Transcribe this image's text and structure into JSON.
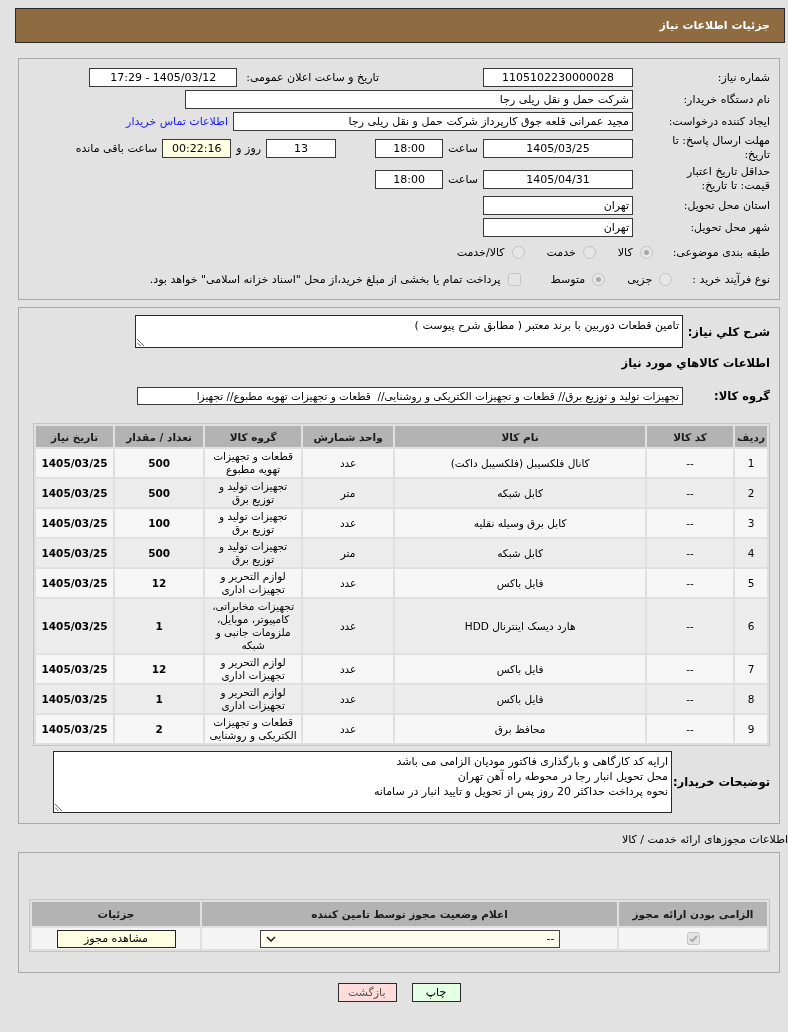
{
  "header": {
    "title": "جزئیات اطلاعات نیاز"
  },
  "need": {
    "need_number": {
      "label": "شماره نیاز:",
      "value": "1105102230000028"
    },
    "announced": {
      "label": "تاریخ و ساعت اعلان عمومی:",
      "value": "1405/03/12 - 17:29"
    },
    "buyer_org": {
      "label": "نام دستگاه خریدار:",
      "value": "شرکت حمل و نقل ریلی رجا"
    },
    "requester": {
      "label": "ایجاد کننده درخواست:",
      "value": "مجید عمرانی قلعه جوق کارپرداز شرکت حمل و نقل ریلی رجا",
      "link": "اطلاعات تماس خریدار"
    },
    "reply_deadline": {
      "label": "مهلت ارسال پاسخ: تا تاریخ:",
      "date": "1405/03/25",
      "time_label": "ساعت",
      "time": "18:00",
      "days": "13",
      "days_label": "روز و",
      "remaining": "00:22:16",
      "remaining_label": "ساعت باقی مانده"
    },
    "price_validity": {
      "label": "حداقل تاریخ اعتبار قیمت: تا تاریخ:",
      "date": "1405/04/31",
      "time_label": "ساعت",
      "time": "18:00"
    },
    "delivery_province": {
      "label": "استان محل تحویل:",
      "value": "تهران"
    },
    "delivery_city": {
      "label": "شهر محل تحویل:",
      "value": "تهران"
    },
    "subject_category": {
      "label": "طبقه بندی موضوعی:",
      "options": [
        {
          "label": "کالا",
          "selected": true,
          "disabled": true
        },
        {
          "label": "خدمت",
          "selected": false,
          "disabled": true
        },
        {
          "label": "کالا/خدمت",
          "selected": false,
          "disabled": true
        }
      ]
    },
    "purchase_process": {
      "label": "نوع فرآیند خرید :",
      "options": [
        {
          "label": "جزیی",
          "selected": false,
          "disabled": true
        },
        {
          "label": "متوسط",
          "selected": true,
          "disabled": true
        }
      ],
      "treasury_option": {
        "label": "پرداخت تمام یا بخشی از مبلغ خرید،از محل \"اسناد خزانه اسلامی\" خواهد بود.",
        "checked": false,
        "disabled": true
      }
    }
  },
  "items": {
    "description_label": "شرح کلي نياز:",
    "description": "تامین قطعات دوربین با برند معتبر ( مطابق شرح پیوست )",
    "heading": "اطلاعات کالاهاي مورد نياز",
    "group_label": "گروه کالا:",
    "group_value": "تجهیزات تولید و توزیع برق// قطعات و تجهیزات الکتریکی و روشنایی//  قطعات و تجهیزات تهویه مطبوع// تجهیزا",
    "table": {
      "columns": [
        "ردیف",
        "کد کالا",
        "نام کالا",
        "واحد شمارش",
        "گروه کالا",
        "تعداد / مقدار",
        "تاریخ نیاز"
      ],
      "rows": [
        {
          "row_number": "1",
          "item_code": "--",
          "item_name": "کانال فلکسیبل (فلکسیبل داکت)",
          "unit": "عدد",
          "item_group": "قطعات و تجهیزات تهویه مطبوع",
          "quantity": "500",
          "need_date": "1405/03/25"
        },
        {
          "row_number": "2",
          "item_code": "--",
          "item_name": "کابل شبکه",
          "unit": "متر",
          "item_group": "تجهیزات تولید و توزیع برق",
          "quantity": "500",
          "need_date": "1405/03/25"
        },
        {
          "row_number": "3",
          "item_code": "--",
          "item_name": "کابل برق وسیله نقلیه",
          "unit": "عدد",
          "item_group": "تجهیزات تولید و توزیع برق",
          "quantity": "100",
          "need_date": "1405/03/25"
        },
        {
          "row_number": "4",
          "item_code": "--",
          "item_name": "کابل شبکه",
          "unit": "متر",
          "item_group": "تجهیزات تولید و توزیع برق",
          "quantity": "500",
          "need_date": "1405/03/25"
        },
        {
          "row_number": "5",
          "item_code": "--",
          "item_name": "فایل باکس",
          "unit": "عدد",
          "item_group": "لوازم التحریر و تجهیزات اداری",
          "quantity": "12",
          "need_date": "1405/03/25"
        },
        {
          "row_number": "6",
          "item_code": "--",
          "item_name": "هارد دیسک اینترنال HDD",
          "unit": "عدد",
          "item_group": "تجهیزات مخابراتی، کامپیوتر، موبایل، ملزومات جانبی و شبکه",
          "quantity": "1",
          "need_date": "1405/03/25"
        },
        {
          "row_number": "7",
          "item_code": "--",
          "item_name": "فایل باکس",
          "unit": "عدد",
          "item_group": "لوازم التحریر و تجهیزات اداری",
          "quantity": "12",
          "need_date": "1405/03/25"
        },
        {
          "row_number": "8",
          "item_code": "--",
          "item_name": "فایل باکس",
          "unit": "عدد",
          "item_group": "لوازم التحریر و تجهیزات اداری",
          "quantity": "1",
          "need_date": "1405/03/25"
        },
        {
          "row_number": "9",
          "item_code": "--",
          "item_name": "محافظ برق",
          "unit": "عدد",
          "item_group": "قطعات و تجهیزات الکتریکی و روشنایی",
          "quantity": "2",
          "need_date": "1405/03/25"
        }
      ]
    },
    "notes_label": "توضیحات خریدار:",
    "notes": "ارایه کد کارگاهی و بارگذاری فاکتور مودیان الزامی می باشد\nمحل تحویل انبار رجا در محوطه راه آهن تهران\nنحوه پرداخت حداکثر 20 روز پس از تحویل و تایید انبار در سامانه"
  },
  "licenses": {
    "heading": "اطلاعات مجوزهای ارائه خدمت / کالا",
    "columns": [
      "الزامی بودن ارائه مجوز",
      "اعلام وضعیت مجوز توسط تامین کننده",
      "جزئیات"
    ],
    "rows": [
      {
        "required": {
          "checked": true,
          "disabled": true
        },
        "status": "--",
        "details_button": "مشاهده مجوز"
      }
    ]
  },
  "actions": [
    {
      "label": "چاپ",
      "kind": "print"
    },
    {
      "label": "بازگشت",
      "kind": "back"
    }
  ]
}
